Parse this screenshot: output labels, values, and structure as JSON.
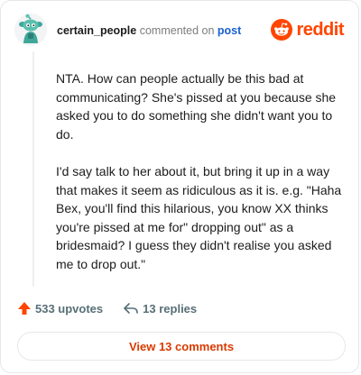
{
  "header": {
    "username": "certain_people",
    "action_text": "commented on",
    "post_link": "post",
    "brand_name": "reddit"
  },
  "comment": {
    "paragraphs": [
      "NTA. How can people actually be this bad at communicating? She's pissed at you because she asked you to do something she didn't want you to do.",
      "I'd say talk to her about it, but bring it up in a way that makes it seem as ridiculous as it is. e.g. \"Haha Bex, you'll find this hilarious, you know XX thinks you're pissed at me for\" dropping out\" as a bridesmaid? I guess they didn't realise you asked me to drop out.\""
    ]
  },
  "actions": {
    "upvotes": "533 upvotes",
    "replies": "13 replies"
  },
  "view_comments": "View 13 comments",
  "colors": {
    "accent": "#ff4500",
    "link": "#1a5fd0",
    "view_button_text": "#d93a00",
    "muted": "#576f76"
  },
  "icons": {
    "avatar": "snoo-avatar",
    "brand": "reddit-logo-icon",
    "upvote": "upvote-arrow-icon",
    "reply": "reply-arrow-icon"
  }
}
